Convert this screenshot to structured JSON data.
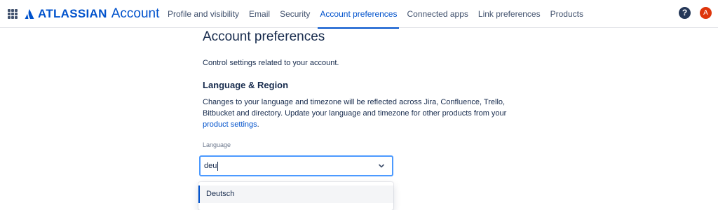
{
  "header": {
    "brand": "ATLASSIAN",
    "product": "Account",
    "nav": [
      {
        "label": "Profile and visibility"
      },
      {
        "label": "Email"
      },
      {
        "label": "Security"
      },
      {
        "label": "Account preferences"
      },
      {
        "label": "Connected apps"
      },
      {
        "label": "Link preferences"
      },
      {
        "label": "Products"
      }
    ],
    "active_nav": "Account preferences",
    "help_icon": "question-circle-icon",
    "help_glyph": "?",
    "avatar_initial": "A"
  },
  "main": {
    "title": "Account preferences",
    "description": "Control settings related to your account.",
    "section": {
      "heading": "Language & Region",
      "body_before_link": "Changes to your language and timezone will be reflected across Jira, Confluence, Trello, Bitbucket and directory. Update your language and timezone for other products from your ",
      "link_text": "product settings",
      "body_after_link": "."
    },
    "language": {
      "label": "Language",
      "input_value": "deu",
      "options": [
        "Deutsch"
      ]
    }
  },
  "colors": {
    "brand_blue": "#0052cc",
    "focus_border": "#4c9aff",
    "avatar_bg": "#de350b",
    "help_bg": "#253858"
  }
}
